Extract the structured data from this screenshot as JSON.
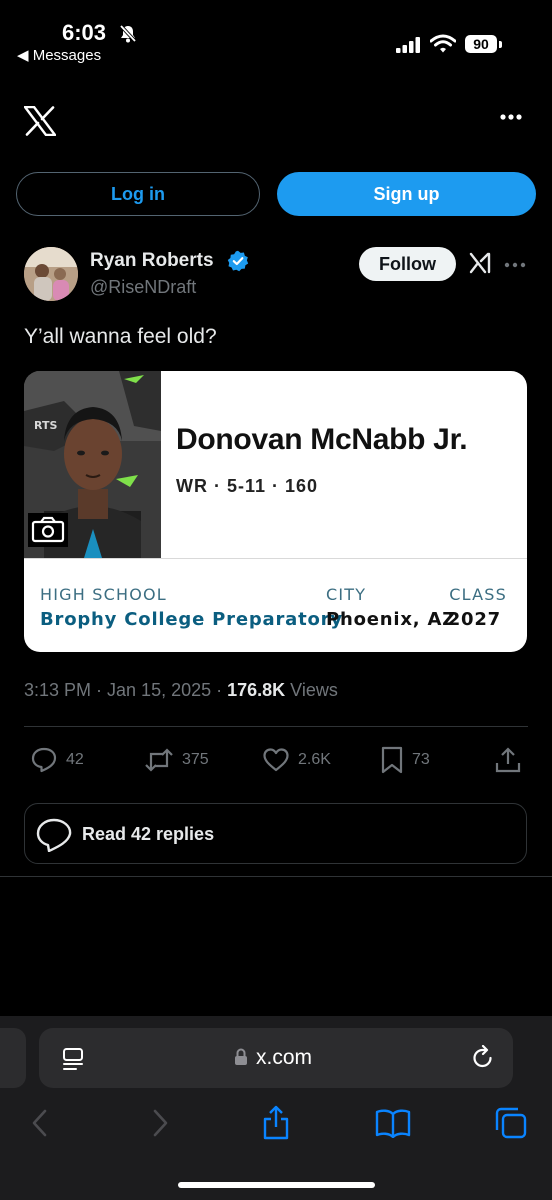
{
  "status_bar": {
    "time": "6:03",
    "back_app": "Messages",
    "battery": "90"
  },
  "nav": {
    "login_label": "Log in",
    "signup_label": "Sign up"
  },
  "post": {
    "author_name": "Ryan Roberts",
    "author_handle": "@RiseNDraft",
    "follow_label": "Follow",
    "text": "Y’all wanna feel old?",
    "card": {
      "player_name": "Donovan McNabb Jr.",
      "position_info": "WR · 5-11 · 160",
      "labels": {
        "school": "HIGH SCHOOL",
        "city": "CITY",
        "class": "CLASS"
      },
      "values": {
        "school": "Brophy College Preparatory",
        "city": "Phoenix, AZ",
        "class": "2027"
      }
    },
    "meta": {
      "time": "3:13 PM · Jan 15, 2025 · ",
      "views_count": "176.8K",
      "views_label": " Views"
    },
    "actions": {
      "replies": "42",
      "reposts": "375",
      "likes": "2.6K",
      "bookmarks": "73"
    },
    "read_replies_label": "Read 42 replies"
  },
  "browser": {
    "url": "x.com"
  },
  "colors": {
    "accent": "#1d9bf0",
    "background": "#000000",
    "muted": "#71767b"
  }
}
